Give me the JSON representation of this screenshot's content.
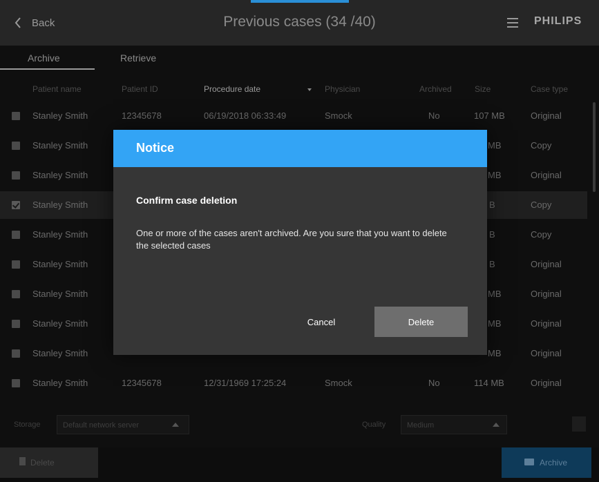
{
  "header": {
    "back_label": "Back",
    "title": "Previous cases (34 /40)",
    "brand": "PHILIPS"
  },
  "tabs": [
    {
      "label": "Archive",
      "active": true
    },
    {
      "label": "Retrieve",
      "active": false
    }
  ],
  "table": {
    "columns": [
      "Patient name",
      "Patient ID",
      "Procedure date",
      "Physician",
      "Archived",
      "Size",
      "Case type"
    ],
    "sorted_column": "Procedure date",
    "rows": [
      {
        "checked": false,
        "name": "Stanley Smith",
        "id": "12345678",
        "date": "06/19/2018 06:33:49",
        "physician": "Smock",
        "archived": "No",
        "size": "107 MB",
        "type": "Original"
      },
      {
        "checked": false,
        "name": "Stanley Smith",
        "id": "",
        "date": "",
        "physician": "",
        "archived": "",
        "size": "MB",
        "type": "Copy"
      },
      {
        "checked": false,
        "name": "Stanley Smith",
        "id": "",
        "date": "",
        "physician": "",
        "archived": "",
        "size": "MB",
        "type": "Original"
      },
      {
        "checked": true,
        "name": "Stanley Smith",
        "id": "",
        "date": "",
        "physician": "",
        "archived": "",
        "size": "B",
        "type": "Copy"
      },
      {
        "checked": false,
        "name": "Stanley Smith",
        "id": "",
        "date": "",
        "physician": "",
        "archived": "",
        "size": "B",
        "type": "Copy"
      },
      {
        "checked": false,
        "name": "Stanley Smith",
        "id": "",
        "date": "",
        "physician": "",
        "archived": "",
        "size": "B",
        "type": "Original"
      },
      {
        "checked": false,
        "name": "Stanley Smith",
        "id": "",
        "date": "",
        "physician": "",
        "archived": "",
        "size": "MB",
        "type": "Original"
      },
      {
        "checked": false,
        "name": "Stanley Smith",
        "id": "",
        "date": "",
        "physician": "",
        "archived": "",
        "size": "MB",
        "type": "Original"
      },
      {
        "checked": false,
        "name": "Stanley Smith",
        "id": "",
        "date": "",
        "physician": "",
        "archived": "",
        "size": "MB",
        "type": "Original"
      },
      {
        "checked": false,
        "name": "Stanley Smith",
        "id": "12345678",
        "date": "12/31/1969 17:25:24",
        "physician": "Smock",
        "archived": "No",
        "size": "114 MB",
        "type": "Original"
      }
    ]
  },
  "controls": {
    "storage_label": "Storage",
    "storage_value": "Default network server",
    "quality_label": "Quality",
    "quality_value": "Medium"
  },
  "footer": {
    "delete_label": "Delete",
    "archive_label": "Archive"
  },
  "dialog": {
    "title": "Notice",
    "heading": "Confirm case deletion",
    "message": "One or more of the cases aren't archived. Are you sure that you want to delete the selected cases",
    "cancel_label": "Cancel",
    "delete_label": "Delete"
  },
  "colors": {
    "dialog_header": "#33a4f5",
    "archive_button": "#0e3a59",
    "dialog_body": "#363636"
  }
}
